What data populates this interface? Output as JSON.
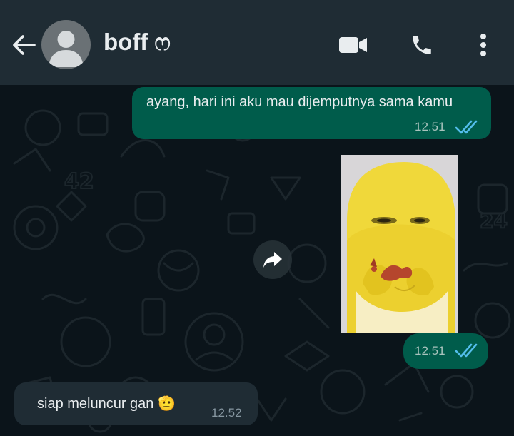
{
  "header": {
    "contact_name": "boff ෆ",
    "icons": {
      "back": "arrow-left-icon",
      "avatar": "default-avatar-icon",
      "video": "video-call-icon",
      "call": "phone-icon",
      "menu": "more-vertical-icon"
    }
  },
  "messages": [
    {
      "direction": "outgoing",
      "type": "text",
      "text": "ayang, hari ini aku mau dijemputnya sama kamu",
      "time": "12.51",
      "status": "read"
    },
    {
      "direction": "outgoing",
      "type": "sticker",
      "time": "12.51",
      "status": "read"
    },
    {
      "direction": "incoming",
      "type": "text",
      "text": "siap meluncur gan 🫡",
      "time": "12.52"
    }
  ],
  "forward_icon": "forward-arrow-icon",
  "colors": {
    "header_bg": "#1f2c34",
    "chat_bg": "#0b141a",
    "outgoing_bubble": "#005c4b",
    "incoming_bubble": "#1f2c34",
    "read_ticks": "#53bdeb"
  }
}
